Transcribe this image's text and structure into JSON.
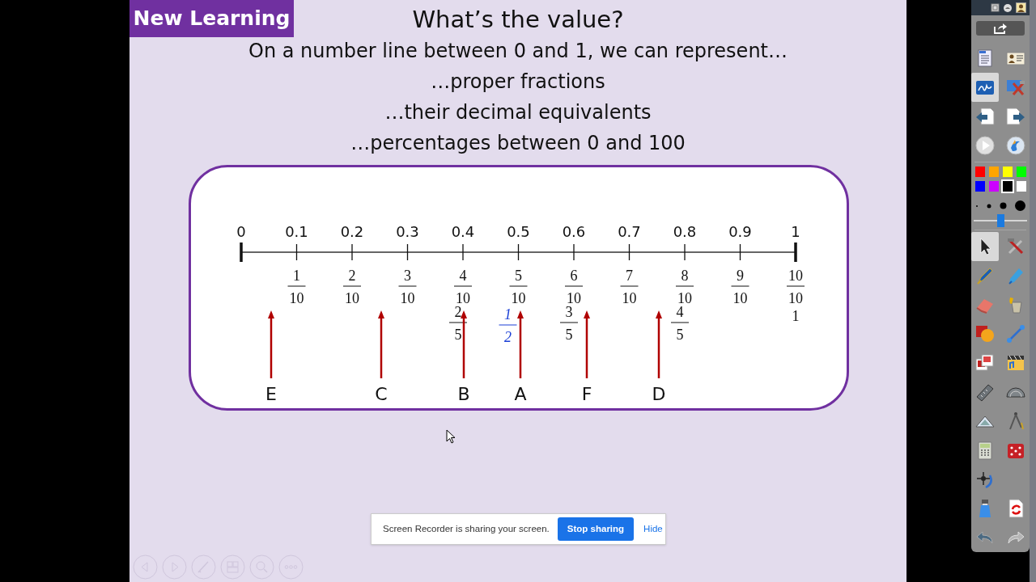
{
  "slide": {
    "tag": "New Learning",
    "title": "What’s the value?",
    "lines": [
      "On a number line between 0 and 1, we can represent…",
      "…proper fractions",
      "…their decimal equivalents",
      "…percentages between 0 and 100"
    ],
    "number_line": {
      "ticks": [
        {
          "decimal": "0"
        },
        {
          "decimal": "0.1",
          "fraction": {
            "num": "1",
            "den": "10"
          }
        },
        {
          "decimal": "0.2",
          "fraction": {
            "num": "2",
            "den": "10"
          }
        },
        {
          "decimal": "0.3",
          "fraction": {
            "num": "3",
            "den": "10"
          }
        },
        {
          "decimal": "0.4",
          "fraction": {
            "num": "4",
            "den": "10"
          },
          "equivalent": {
            "num": "2",
            "den": "5"
          }
        },
        {
          "decimal": "0.5",
          "fraction": {
            "num": "5",
            "den": "10"
          },
          "handwritten": {
            "num": "1",
            "den": "2"
          }
        },
        {
          "decimal": "0.6",
          "fraction": {
            "num": "6",
            "den": "10"
          },
          "equivalent": {
            "num": "3",
            "den": "5"
          }
        },
        {
          "decimal": "0.7",
          "fraction": {
            "num": "7",
            "den": "10"
          }
        },
        {
          "decimal": "0.8",
          "fraction": {
            "num": "8",
            "den": "10"
          },
          "equivalent": {
            "num": "4",
            "den": "5"
          }
        },
        {
          "decimal": "0.9",
          "fraction": {
            "num": "9",
            "den": "10"
          }
        },
        {
          "decimal": "1",
          "fraction": {
            "num": "10",
            "den": "10"
          },
          "whole": "1"
        }
      ],
      "arrows": [
        "E",
        "C",
        "B",
        "A",
        "F",
        "D"
      ]
    }
  },
  "sharing_bar": {
    "message": "Screen Recorder is sharing your screen.",
    "stop_button": "Stop sharing",
    "hide_link": "Hide"
  },
  "toolbar": {
    "tools_top": [
      {
        "kind": "document-menu",
        "selected": false
      },
      {
        "kind": "id-card",
        "selected": false
      },
      {
        "kind": "pen-window",
        "selected": true
      },
      {
        "kind": "tools-window",
        "selected": false
      },
      {
        "kind": "page-back",
        "selected": false
      },
      {
        "kind": "page-forward",
        "selected": false
      },
      {
        "kind": "play",
        "selected": false
      },
      {
        "kind": "flash",
        "selected": false
      }
    ],
    "colors": [
      {
        "color": "#ff0000",
        "selected": false
      },
      {
        "color": "#ffa500",
        "selected": false
      },
      {
        "color": "#ffff00",
        "selected": false
      },
      {
        "color": "#00ff00",
        "selected": false
      },
      {
        "color": "#0000ff",
        "selected": false
      },
      {
        "color": "#cc00ff",
        "selected": false
      },
      {
        "color": "#000000",
        "selected": true
      },
      {
        "color": "#ffffff",
        "selected": false
      }
    ],
    "thickness_slider": {
      "level": 0.5
    },
    "tools": [
      {
        "kind": "pointer",
        "selected": true
      },
      {
        "kind": "hammer-wrench",
        "selected": false
      },
      {
        "kind": "pen",
        "selected": false
      },
      {
        "kind": "highlighter",
        "selected": false
      },
      {
        "kind": "eraser",
        "selected": false
      },
      {
        "kind": "paint-bucket",
        "selected": false
      },
      {
        "kind": "shapes",
        "selected": false
      },
      {
        "kind": "line",
        "selected": false
      },
      {
        "kind": "page-gallery",
        "selected": false
      },
      {
        "kind": "media",
        "selected": false
      },
      {
        "kind": "ruler",
        "selected": false
      },
      {
        "kind": "protractor",
        "selected": false
      },
      {
        "kind": "set-square",
        "selected": false
      },
      {
        "kind": "compass",
        "selected": false
      },
      {
        "kind": "calculator",
        "selected": false
      },
      {
        "kind": "dice",
        "selected": false
      },
      {
        "kind": "spotlight",
        "selected": false
      },
      {
        "kind": "spray",
        "selected": false
      },
      {
        "kind": "refresh-page",
        "selected": false
      },
      {
        "kind": "undo",
        "selected": false
      },
      {
        "kind": "redo",
        "selected": false
      }
    ]
  }
}
